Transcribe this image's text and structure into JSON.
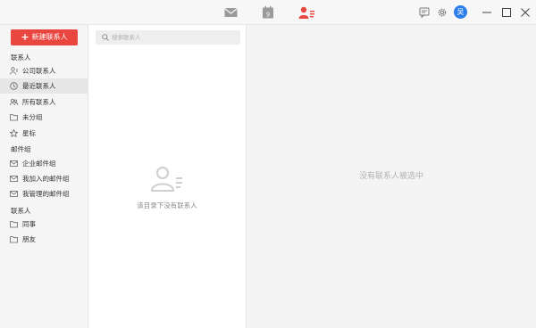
{
  "topbar": {
    "nav": [
      {
        "icon": "mail-icon"
      },
      {
        "icon": "calendar-icon",
        "day": "9"
      },
      {
        "icon": "contacts-icon"
      }
    ],
    "avatar_text": "吴"
  },
  "sidebar": {
    "new_contact_label": "新建联系人",
    "section_contacts": "联系人",
    "items_contacts": [
      {
        "label": "公司联系人",
        "icon": "company-contacts-icon"
      },
      {
        "label": "最近联系人",
        "icon": "clock-icon"
      },
      {
        "label": "所有联系人",
        "icon": "people-icon"
      },
      {
        "label": "未分组",
        "icon": "folder-icon"
      },
      {
        "label": "星标",
        "icon": "star-icon"
      }
    ],
    "section_mailgroups": "邮件组",
    "items_mailgroups": [
      {
        "label": "企业邮件组",
        "icon": "mail-group-icon"
      },
      {
        "label": "我加入的邮件组",
        "icon": "mail-group-icon"
      },
      {
        "label": "我管理的邮件组",
        "icon": "mail-group-icon"
      }
    ],
    "section_groups": "联系人",
    "items_groups": [
      {
        "label": "同事",
        "icon": "folder-icon"
      },
      {
        "label": "朋友",
        "icon": "folder-icon"
      }
    ]
  },
  "list": {
    "search_placeholder": "搜索联系人",
    "empty_text": "该目录下没有联系人"
  },
  "detail": {
    "empty_text": "没有联系人被选中"
  },
  "colors": {
    "accent": "#e9463f",
    "avatar": "#2b7de9"
  }
}
